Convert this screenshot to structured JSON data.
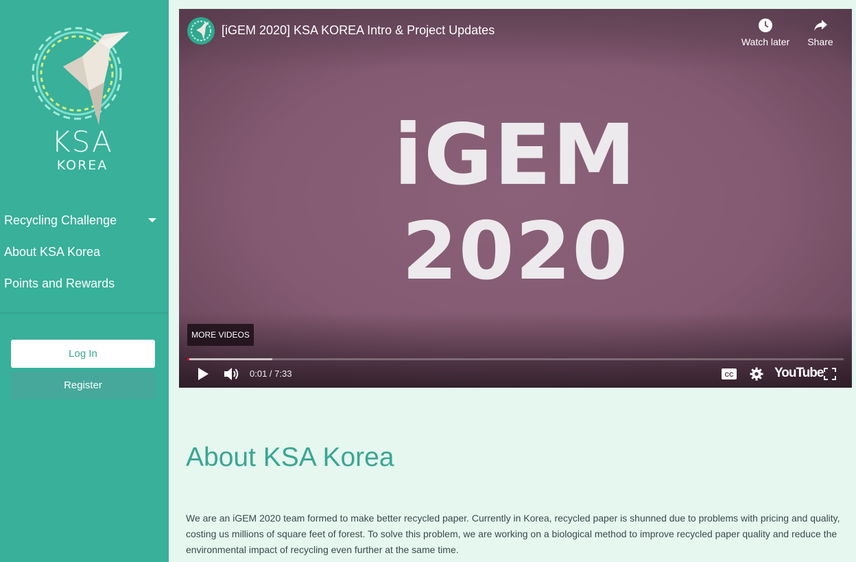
{
  "sidebar": {
    "logo": {
      "line1": "KSA",
      "line2": "KOREA"
    },
    "nav": [
      {
        "label": "Recycling Challenge",
        "has_dropdown": true
      },
      {
        "label": "About KSA Korea"
      },
      {
        "label": "Points and Rewards"
      }
    ],
    "login_label": "Log In",
    "register_label": "Register"
  },
  "video": {
    "title": "[iGEM 2020] KSA KOREA Intro & Project Updates",
    "watch_later_label": "Watch later",
    "share_label": "Share",
    "frame_line1": "iGEM",
    "frame_line2": "2020",
    "more_videos_label": "MORE VIDEOS",
    "time": "0:01 / 7:33",
    "progress_played_fraction": 0.002,
    "progress_loaded_fraction": 0.13,
    "platform_logo": "YouTube",
    "icons": [
      "play-icon",
      "volume-icon",
      "captions-icon",
      "settings-icon",
      "fullscreen-icon",
      "clock-icon",
      "share-arrow-icon"
    ]
  },
  "about": {
    "heading": "About KSA Korea",
    "body": "We are an iGEM 2020 team formed to make better recycled paper. Currently in Korea, recycled paper is shunned due to problems with pricing and quality, costing us millions of square feet of forest. To solve this problem, we are working on a biological method to improve recycled paper quality and reduce the environmental impact of recycling even further at the same time."
  },
  "colors": {
    "sidebar": "#38b09a",
    "page_bg": "#e5f7ef",
    "accent": "#3aa693",
    "register_bg": "#46a89b"
  }
}
